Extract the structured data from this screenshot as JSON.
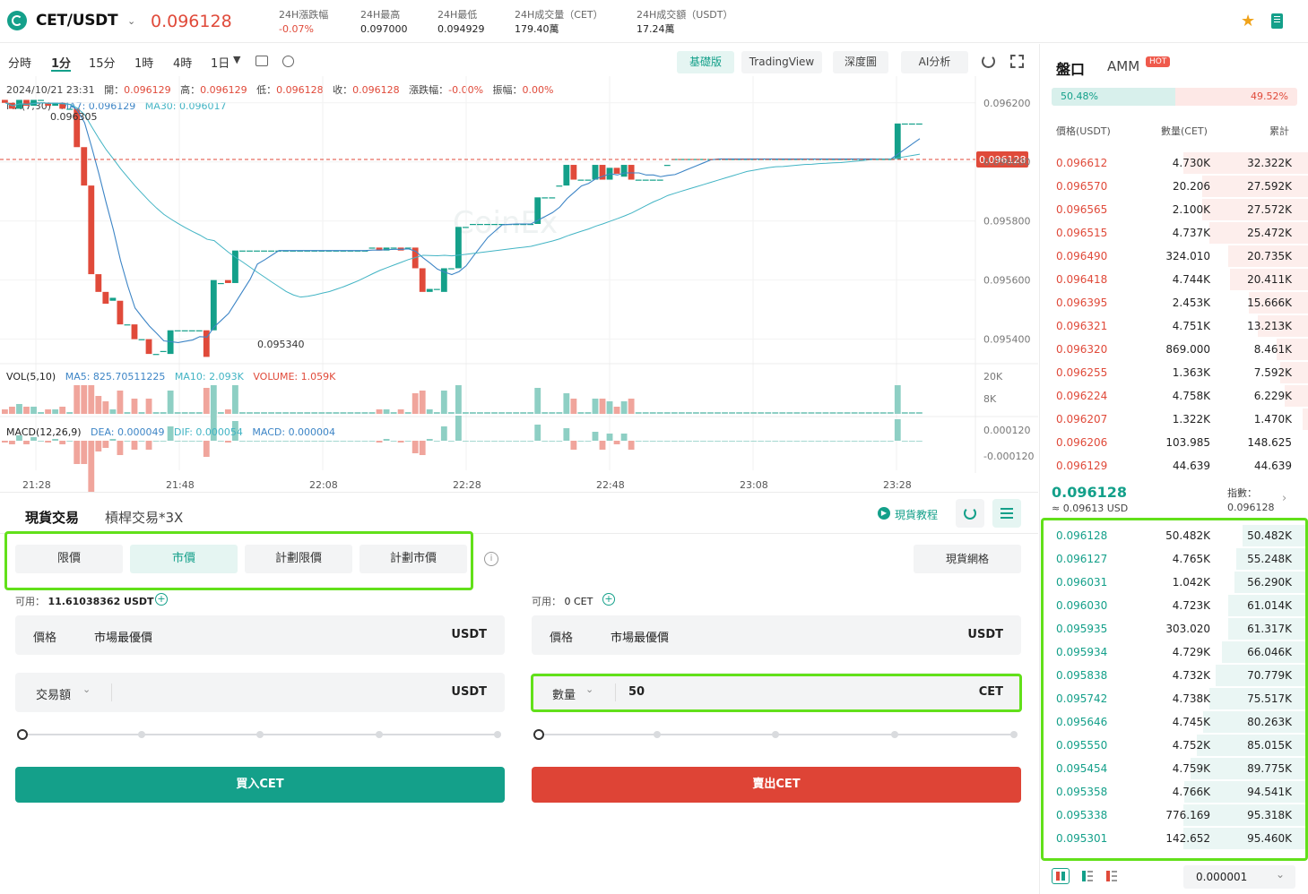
{
  "header": {
    "pair": "CET/USDT",
    "last_price": "0.096128",
    "stats": [
      {
        "label": "24H漲跌幅",
        "value": "-0.07%",
        "color": "#e04a3a"
      },
      {
        "label": "24H最高",
        "value": "0.097000",
        "color": "#222222"
      },
      {
        "label": "24H最低",
        "value": "0.094929",
        "color": "#222222"
      },
      {
        "label": "24H成交量（CET）",
        "value": "179.40萬",
        "color": "#222222"
      },
      {
        "label": "24H成交額（USDT）",
        "value": "17.24萬",
        "color": "#222222"
      }
    ]
  },
  "chart_toolbar": {
    "intervals": [
      "分時",
      "1分",
      "15分",
      "1時",
      "4時",
      "1日"
    ],
    "active_interval": "1分",
    "views": [
      "基礎版",
      "TradingView",
      "深度圖",
      "AI分析"
    ],
    "active_view": "基礎版"
  },
  "ohlc": {
    "date": "2024/10/21 23:31",
    "open_label": "開：",
    "open": "0.096129",
    "high_label": "高：",
    "high": "0.096129",
    "low_label": "低：",
    "low": "0.096128",
    "close_label": "收：",
    "close": "0.096128",
    "chg_label": "漲跌幅：",
    "chg": "-0.00%",
    "amp_label": "振幅：",
    "amp": "0.00%"
  },
  "ma": {
    "label": "MA(7,30)",
    "ma7": "MA7: 0.096129",
    "ma30": "MA30: 0.096017"
  },
  "vol": {
    "label": "VOL(5,10)",
    "ma5": "MA5: 825.70511225",
    "ma10": "MA10: 2.093K",
    "volume": "VOLUME: 1.059K",
    "ticks": [
      "20K",
      "8K"
    ]
  },
  "macd": {
    "label": "MACD(12,26,9)",
    "dea": "DEA: 0.000049",
    "dif": "DIF: 0.000054",
    "macd": "MACD: 0.000004",
    "ticks": [
      "0.000120",
      "-0.000120"
    ]
  },
  "chart_data": {
    "type": "candlestick",
    "price_ticks": [
      "0.096200",
      "0.096000",
      "0.095800",
      "0.095600",
      "0.095400"
    ],
    "current_price_tag": "0.096128",
    "high_marker": "0.096305",
    "low_marker": "0.095340",
    "watermark": "CoinEx",
    "x_ticks": [
      "21:28",
      "21:48",
      "22:08",
      "22:28",
      "22:48",
      "23:08",
      "23:28"
    ],
    "ylim": [
      0.09532,
      0.09626
    ],
    "candles": [
      [
        0.09621,
        0.0962
      ],
      [
        0.0962,
        0.09618
      ],
      [
        0.09618,
        0.09621
      ],
      [
        0.09621,
        0.09619
      ],
      [
        0.09619,
        0.09621
      ],
      [
        0.09621,
        0.09621
      ],
      [
        0.0962,
        0.09619
      ],
      [
        0.09619,
        0.0962
      ],
      [
        0.0962,
        0.09618
      ],
      [
        0.09618,
        0.09618
      ],
      [
        0.09618,
        0.09605
      ],
      [
        0.09605,
        0.09592
      ],
      [
        0.09592,
        0.09562
      ],
      [
        0.09562,
        0.09556
      ],
      [
        0.09556,
        0.09552
      ],
      [
        0.09553,
        0.09554
      ],
      [
        0.09553,
        0.09545
      ],
      [
        0.09545,
        0.09545
      ],
      [
        0.09545,
        0.0954
      ],
      [
        0.0954,
        0.0954
      ],
      [
        0.0954,
        0.09535
      ],
      [
        0.09535,
        0.09535
      ],
      [
        0.09536,
        0.09536
      ],
      [
        0.09535,
        0.09543
      ],
      [
        0.09543,
        0.09543
      ],
      [
        0.09543,
        0.09543
      ],
      [
        0.09543,
        0.09543
      ],
      [
        0.09543,
        0.09543
      ],
      [
        0.09543,
        0.09534
      ],
      [
        0.09543,
        0.0956
      ],
      [
        0.09559,
        0.09559
      ],
      [
        0.0956,
        0.09559
      ],
      [
        0.09559,
        0.0957
      ],
      [
        0.0957,
        0.0957
      ],
      [
        0.0957,
        0.0957
      ],
      [
        0.0957,
        0.0957
      ],
      [
        0.0957,
        0.0957
      ],
      [
        0.0957,
        0.0957
      ],
      [
        0.0957,
        0.0957
      ],
      [
        0.0957,
        0.0957
      ],
      [
        0.0957,
        0.0957
      ],
      [
        0.0957,
        0.0957
      ],
      [
        0.0957,
        0.0957
      ],
      [
        0.0957,
        0.0957
      ],
      [
        0.0957,
        0.0957
      ],
      [
        0.0957,
        0.0957
      ],
      [
        0.0957,
        0.0957
      ],
      [
        0.0957,
        0.0957
      ],
      [
        0.0957,
        0.0957
      ],
      [
        0.0957,
        0.0957
      ],
      [
        0.0957,
        0.0957
      ],
      [
        0.09571,
        0.09571
      ],
      [
        0.09571,
        0.0957
      ],
      [
        0.0957,
        0.09571
      ],
      [
        0.09571,
        0.09571
      ],
      [
        0.09571,
        0.0957
      ],
      [
        0.09571,
        0.09571
      ],
      [
        0.09571,
        0.09564
      ],
      [
        0.09564,
        0.09556
      ],
      [
        0.09556,
        0.09557
      ],
      [
        0.09557,
        0.09557
      ],
      [
        0.09556,
        0.09564
      ],
      [
        0.09564,
        0.09564
      ],
      [
        0.09564,
        0.09578
      ],
      [
        0.09578,
        0.09578
      ],
      [
        0.09579,
        0.09579
      ],
      [
        0.09579,
        0.09579
      ],
      [
        0.09579,
        0.09579
      ],
      [
        0.09579,
        0.09579
      ],
      [
        0.09579,
        0.09579
      ],
      [
        0.09579,
        0.09579
      ],
      [
        0.09579,
        0.09579
      ],
      [
        0.09579,
        0.09579
      ],
      [
        0.09579,
        0.09579
      ],
      [
        0.09579,
        0.09588
      ],
      [
        0.09588,
        0.09588
      ],
      [
        0.09588,
        0.09588
      ],
      [
        0.09592,
        0.09592
      ],
      [
        0.09592,
        0.09599
      ],
      [
        0.09599,
        0.09594
      ],
      [
        0.09594,
        0.09594
      ],
      [
        0.09594,
        0.09594
      ],
      [
        0.09594,
        0.09599
      ],
      [
        0.09599,
        0.09594
      ],
      [
        0.09594,
        0.09598
      ],
      [
        0.09598,
        0.09596
      ],
      [
        0.09595,
        0.09599
      ],
      [
        0.09599,
        0.09594
      ],
      [
        0.09594,
        0.09594
      ],
      [
        0.09594,
        0.09594
      ],
      [
        0.09594,
        0.09594
      ],
      [
        0.09594,
        0.09594
      ],
      [
        0.09599,
        0.09599
      ],
      [
        0.09601,
        0.09601
      ],
      [
        0.09601,
        0.09601
      ],
      [
        0.09601,
        0.09601
      ],
      [
        0.09601,
        0.09601
      ],
      [
        0.09601,
        0.09601
      ],
      [
        0.09601,
        0.09601
      ],
      [
        0.09601,
        0.09601
      ],
      [
        0.09601,
        0.09601
      ],
      [
        0.09601,
        0.09601
      ],
      [
        0.09601,
        0.09601
      ],
      [
        0.09601,
        0.09601
      ],
      [
        0.09601,
        0.09601
      ],
      [
        0.09601,
        0.09601
      ],
      [
        0.09601,
        0.09601
      ],
      [
        0.09601,
        0.09601
      ],
      [
        0.09601,
        0.09601
      ],
      [
        0.09601,
        0.09601
      ],
      [
        0.09601,
        0.09601
      ],
      [
        0.09601,
        0.09601
      ],
      [
        0.09601,
        0.09601
      ],
      [
        0.09601,
        0.09601
      ],
      [
        0.09601,
        0.09601
      ],
      [
        0.09601,
        0.09601
      ],
      [
        0.09601,
        0.09601
      ],
      [
        0.09601,
        0.09601
      ],
      [
        0.09601,
        0.09601
      ],
      [
        0.09601,
        0.09601
      ],
      [
        0.09601,
        0.09601
      ],
      [
        0.09601,
        0.09601
      ],
      [
        0.09601,
        0.09601
      ],
      [
        0.09601,
        0.09601
      ],
      [
        0.09601,
        0.09613
      ],
      [
        0.09613,
        0.09613
      ],
      [
        0.09613,
        0.09613
      ],
      [
        0.09613,
        0.09613
      ]
    ]
  },
  "trade_tabs": {
    "spot": "現貨交易",
    "margin": "槓桿交易*3X",
    "tutorial": "現貨教程",
    "grid": "現貨網格"
  },
  "order_types": [
    "限價",
    "市價",
    "計劃限價",
    "計劃市價"
  ],
  "active_order_type": "市價",
  "buy": {
    "avail_label": "可用：",
    "avail_value": "11.61038362 USDT",
    "price_label": "價格",
    "price_value": "市場最優價",
    "price_unit": "USDT",
    "amount_label": "交易額",
    "amount_value": "",
    "amount_unit": "USDT",
    "button": "買入CET"
  },
  "sell": {
    "avail_label": "可用：",
    "avail_value": "0 CET",
    "price_label": "價格",
    "price_value": "市場最優價",
    "price_unit": "USDT",
    "amount_label": "數量",
    "amount_value": "50",
    "amount_unit": "CET",
    "button": "賣出CET"
  },
  "orderbook": {
    "tab_book": "盤口",
    "tab_amm": "AMM",
    "hot": "HOT",
    "buy_ratio": "50.48%",
    "sell_ratio": "49.52%",
    "buy_ratio_value": 50.48,
    "headers": [
      "價格(USDT)",
      "數量(CET)",
      "累計"
    ],
    "asks": [
      {
        "price": "0.096612",
        "amount": "4.730K",
        "total": "32.322K",
        "depth": 100
      },
      {
        "price": "0.096570",
        "amount": "20.206",
        "total": "27.592K",
        "depth": 85
      },
      {
        "price": "0.096565",
        "amount": "2.100K",
        "total": "27.572K",
        "depth": 85
      },
      {
        "price": "0.096515",
        "amount": "4.737K",
        "total": "25.472K",
        "depth": 79
      },
      {
        "price": "0.096490",
        "amount": "324.010",
        "total": "20.735K",
        "depth": 64
      },
      {
        "price": "0.096418",
        "amount": "4.744K",
        "total": "20.411K",
        "depth": 63
      },
      {
        "price": "0.096395",
        "amount": "2.453K",
        "total": "15.666K",
        "depth": 48
      },
      {
        "price": "0.096321",
        "amount": "4.751K",
        "total": "13.213K",
        "depth": 41
      },
      {
        "price": "0.096320",
        "amount": "869.000",
        "total": "8.461K",
        "depth": 26
      },
      {
        "price": "0.096255",
        "amount": "1.363K",
        "total": "7.592K",
        "depth": 23
      },
      {
        "price": "0.096224",
        "amount": "4.758K",
        "total": "6.229K",
        "depth": 19
      },
      {
        "price": "0.096207",
        "amount": "1.322K",
        "total": "1.470K",
        "depth": 5
      },
      {
        "price": "0.096206",
        "amount": "103.985",
        "total": "148.625",
        "depth": 1
      },
      {
        "price": "0.096129",
        "amount": "44.639",
        "total": "44.639",
        "depth": 0
      }
    ],
    "last_price": "0.096128",
    "last_usd": "≈ 0.09613  USD",
    "index_label": "指數：",
    "index_value": "0.096128",
    "bids": [
      {
        "price": "0.096128",
        "amount": "50.482K",
        "total": "50.482K",
        "depth": 53
      },
      {
        "price": "0.096127",
        "amount": "4.765K",
        "total": "55.248K",
        "depth": 58
      },
      {
        "price": "0.096031",
        "amount": "1.042K",
        "total": "56.290K",
        "depth": 59
      },
      {
        "price": "0.096030",
        "amount": "4.723K",
        "total": "61.014K",
        "depth": 64
      },
      {
        "price": "0.095935",
        "amount": "303.020",
        "total": "61.317K",
        "depth": 64
      },
      {
        "price": "0.095934",
        "amount": "4.729K",
        "total": "66.046K",
        "depth": 69
      },
      {
        "price": "0.095838",
        "amount": "4.732K",
        "total": "70.779K",
        "depth": 74
      },
      {
        "price": "0.095742",
        "amount": "4.738K",
        "total": "75.517K",
        "depth": 79
      },
      {
        "price": "0.095646",
        "amount": "4.745K",
        "total": "80.263K",
        "depth": 84
      },
      {
        "price": "0.095550",
        "amount": "4.752K",
        "total": "85.015K",
        "depth": 89
      },
      {
        "price": "0.095454",
        "amount": "4.759K",
        "total": "89.775K",
        "depth": 94
      },
      {
        "price": "0.095358",
        "amount": "4.766K",
        "total": "94.541K",
        "depth": 99
      },
      {
        "price": "0.095338",
        "amount": "776.169",
        "total": "95.318K",
        "depth": 100
      },
      {
        "price": "0.095301",
        "amount": "142.652",
        "total": "95.460K",
        "depth": 100
      }
    ],
    "precision": "0.000001"
  },
  "colors": {
    "up": "#14a08a",
    "down": "#e04a3a",
    "highlight": "#62e01a"
  }
}
